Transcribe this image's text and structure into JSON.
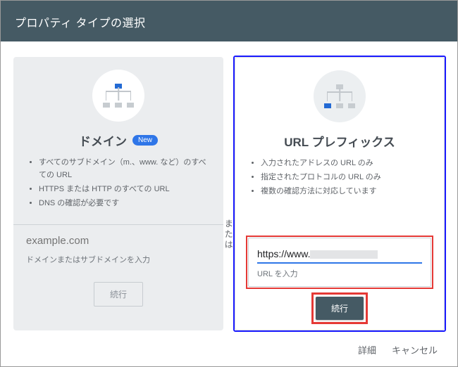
{
  "header": {
    "title": "プロパティ タイプの選択"
  },
  "divider_label": "または",
  "left": {
    "title": "ドメイン",
    "badge": "New",
    "bullets": [
      "すべてのサブドメイン（m.、www. など）のすべての URL",
      "HTTPS または HTTP のすべての URL",
      "DNS の確認が必要です"
    ],
    "placeholder": "example.com",
    "caption": "ドメインまたはサブドメインを入力",
    "button": "続行"
  },
  "right": {
    "title": "URL プレフィックス",
    "bullets": [
      "入力されたアドレスの URL のみ",
      "指定されたプロトコルの URL のみ",
      "複数の確認方法に対応しています"
    ],
    "value_prefix": "https://www.",
    "caption": "URL を入力",
    "button": "続行"
  },
  "footer": {
    "details": "詳細",
    "cancel": "キャンセル"
  }
}
